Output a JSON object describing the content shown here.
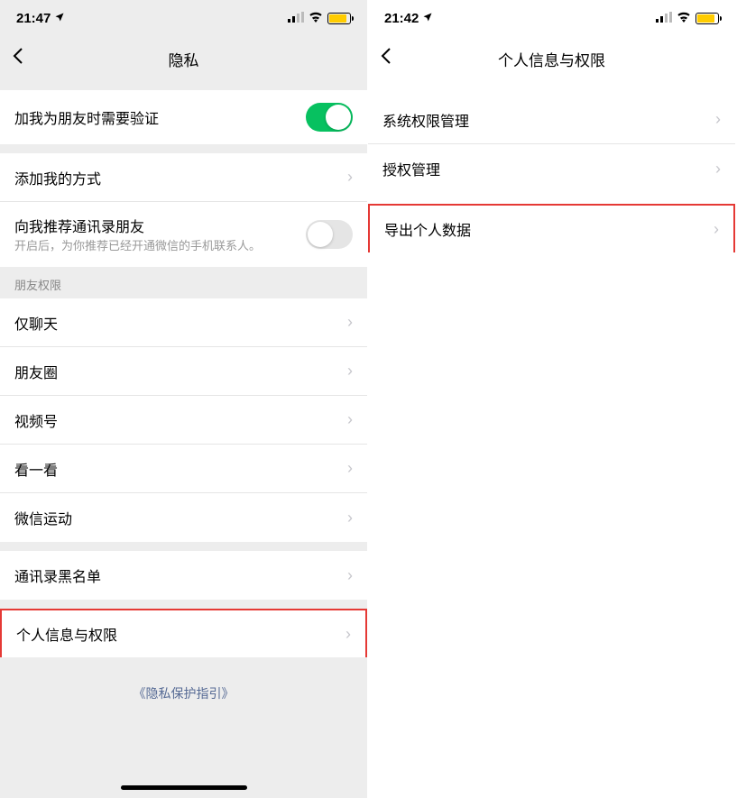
{
  "left": {
    "status": {
      "time": "21:47",
      "locationIcon": "location-arrow"
    },
    "nav": {
      "title": "隐私"
    },
    "row_verify": {
      "title": "加我为朋友时需要验证",
      "toggle": true
    },
    "row_add_method": {
      "title": "添加我的方式"
    },
    "row_recommend": {
      "title": "向我推荐通讯录朋友",
      "subtitle": "开启后，为你推荐已经开通微信的手机联系人。",
      "toggle": false
    },
    "section_friends": {
      "header": "朋友权限"
    },
    "row_chat_only": {
      "title": "仅聊天"
    },
    "row_moments": {
      "title": "朋友圈"
    },
    "row_channels": {
      "title": "视频号"
    },
    "row_topstories": {
      "title": "看一看"
    },
    "row_werun": {
      "title": "微信运动"
    },
    "row_blocklist": {
      "title": "通讯录黑名单"
    },
    "row_personal_info": {
      "title": "个人信息与权限"
    },
    "footer": {
      "link": "《隐私保护指引》"
    }
  },
  "right": {
    "status": {
      "time": "21:42"
    },
    "nav": {
      "title": "个人信息与权限"
    },
    "row_system_perm": {
      "title": "系统权限管理"
    },
    "row_auth": {
      "title": "授权管理"
    },
    "row_export": {
      "title": "导出个人数据"
    }
  }
}
